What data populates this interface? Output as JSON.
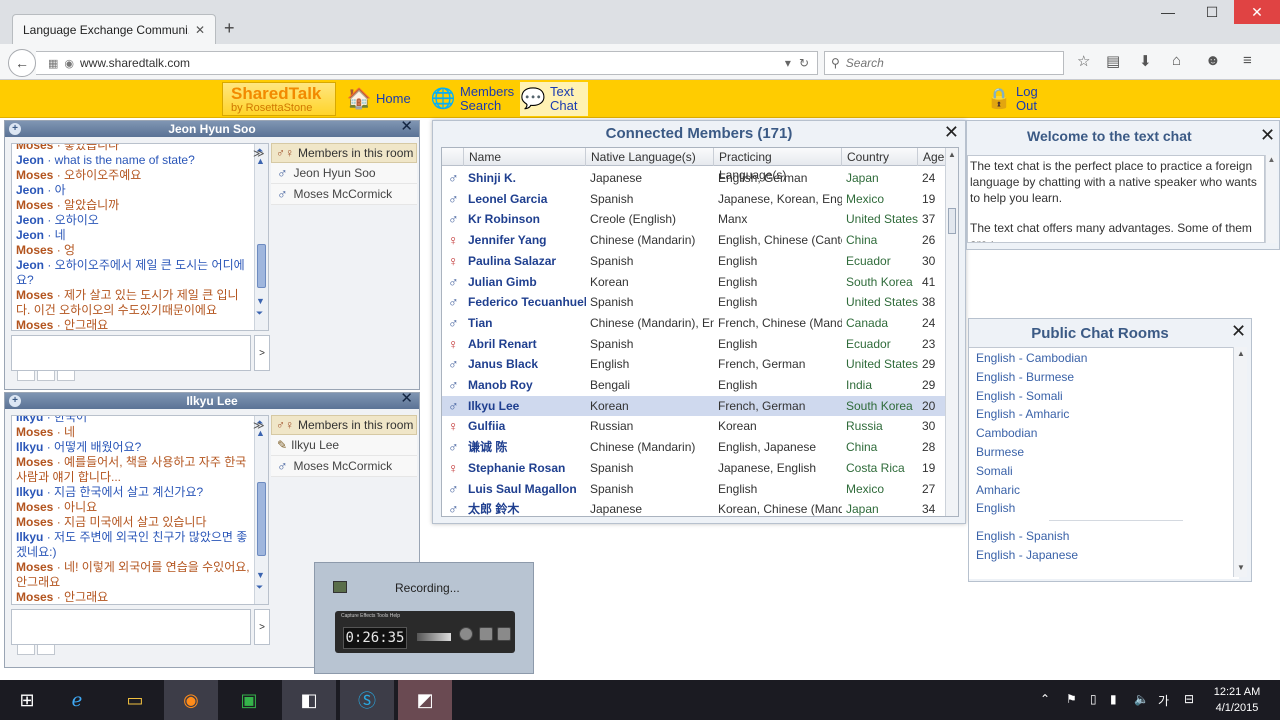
{
  "browser": {
    "tab_title": "Language Exchange Communi...",
    "url": "www.sharedtalk.com",
    "search_placeholder": "Search"
  },
  "site": {
    "logo_main": "SharedTalk",
    "logo_sub": "by RosettaStone",
    "nav": {
      "home": "Home",
      "members_search_1": "Members",
      "members_search_2": "Search",
      "text_chat_1": "Text",
      "text_chat_2": "Chat",
      "logout_1": "Log",
      "logout_2": "Out"
    }
  },
  "chat1": {
    "title": "Jeon Hyun Soo",
    "messages": [
      {
        "who": "Moses",
        "txt": " · 좋았습니다"
      },
      {
        "who": "Jeon",
        "txt": " · what is the name of state?"
      },
      {
        "who": "Moses",
        "txt": " · 오하이오주예요"
      },
      {
        "who": "Jeon",
        "txt": " · 아"
      },
      {
        "who": "Moses",
        "txt": " · 알았습니까"
      },
      {
        "who": "Jeon",
        "txt": " · 오하이오"
      },
      {
        "who": "Jeon",
        "txt": " · 네"
      },
      {
        "who": "Moses",
        "txt": " · 엉"
      },
      {
        "who": "Jeon",
        "txt": " · 오하이오주에서 제일 큰 도시는 어디에요?"
      },
      {
        "who": "Moses",
        "txt": " · 제가 살고 있는 도시가 제일 큰 입니다. 이건 오하이오의 수도있기때문이에요"
      },
      {
        "who": "Moses",
        "txt": " · 안그래요"
      }
    ],
    "members_header": "Members in this room",
    "members": [
      "Jeon Hyun Soo",
      "Moses McCormick"
    ]
  },
  "chat2": {
    "title": "Ilkyu Lee",
    "messages": [
      {
        "who": "Ilkyu",
        "txt": " · 한국어"
      },
      {
        "who": "Moses",
        "txt": " · 네"
      },
      {
        "who": "Ilkyu",
        "txt": " · 어떻게 배웠어요?"
      },
      {
        "who": "Moses",
        "txt": " · 예를들어서, 책을 사용하고 자주 한국사람과 얘기 합니다..."
      },
      {
        "who": "Ilkyu",
        "txt": " · 지금 한국에서 살고 계신가요?"
      },
      {
        "who": "Moses",
        "txt": " · 아니요"
      },
      {
        "who": "Moses",
        "txt": " · 지금 미국에서 살고 있습니다"
      },
      {
        "who": "Ilkyu",
        "txt": " · 저도 주변에 외국인 친구가 많았으면 좋겠네요:)"
      },
      {
        "who": "Moses",
        "txt": " · 네! 이렇게 외국어를 연습을 수있어요, 안그래요"
      },
      {
        "who": "Moses",
        "txt": " · 안그래요"
      }
    ],
    "members_header": "Members in this room",
    "members": [
      "Ilkyu Lee",
      "Moses McCormick"
    ]
  },
  "connected": {
    "title": "Connected Members (171)",
    "columns": [
      "Name",
      "Native Language(s)",
      "Practicing Language(s)",
      "Country",
      "Age"
    ],
    "rows": [
      {
        "g": "m",
        "name": "Shinji K.",
        "native": "Japanese",
        "prac": "English, German",
        "country": "Japan",
        "age": "24"
      },
      {
        "g": "m",
        "name": "Leonel Garcia",
        "native": "Spanish",
        "prac": "Japanese, Korean, Eng",
        "country": "Mexico",
        "age": "19"
      },
      {
        "g": "m",
        "name": "Kr Robinson",
        "native": "Creole (English)",
        "prac": "Manx",
        "country": "United States",
        "age": "37"
      },
      {
        "g": "f",
        "name": "Jennifer Yang",
        "native": "Chinese (Mandarin)",
        "prac": "English, Chinese (Canto",
        "country": "China",
        "age": "26"
      },
      {
        "g": "f",
        "name": "Paulina Salazar",
        "native": "Spanish",
        "prac": "English",
        "country": "Ecuador",
        "age": "30"
      },
      {
        "g": "m",
        "name": "Julian Gimb",
        "native": "Korean",
        "prac": "English",
        "country": "South Korea",
        "age": "41"
      },
      {
        "g": "m",
        "name": "Federico Tecuanhuehu",
        "native": "Spanish",
        "prac": "English",
        "country": "United States",
        "age": "38"
      },
      {
        "g": "m",
        "name": "Tian",
        "native": "Chinese (Mandarin), En",
        "prac": "French, Chinese (Mand",
        "country": "Canada",
        "age": "24"
      },
      {
        "g": "f",
        "name": "Abril Renart",
        "native": "Spanish",
        "prac": "English",
        "country": "Ecuador",
        "age": "23"
      },
      {
        "g": "m",
        "name": "Janus Black",
        "native": "English",
        "prac": "French, German",
        "country": "United States",
        "age": "29"
      },
      {
        "g": "m",
        "name": "Manob Roy",
        "native": "Bengali",
        "prac": "English",
        "country": "India",
        "age": "29"
      },
      {
        "g": "m",
        "name": "Ilkyu Lee",
        "native": "Korean",
        "prac": "French, German",
        "country": "South Korea",
        "age": "20",
        "sel": true
      },
      {
        "g": "f",
        "name": "Gulfiia",
        "native": "Russian",
        "prac": "Korean",
        "country": "Russia",
        "age": "30"
      },
      {
        "g": "m",
        "name": "谦诚 陈",
        "native": "Chinese (Mandarin)",
        "prac": "English, Japanese",
        "country": "China",
        "age": "28"
      },
      {
        "g": "f",
        "name": "Stephanie Rosan",
        "native": "Spanish",
        "prac": "Japanese, English",
        "country": "Costa Rica",
        "age": "19"
      },
      {
        "g": "m",
        "name": "Luis Saul Magallon",
        "native": "Spanish",
        "prac": "English",
        "country": "Mexico",
        "age": "27"
      },
      {
        "g": "m",
        "name": "太郎 鈴木",
        "native": "Japanese",
        "prac": "Korean, Chinese (Mand",
        "country": "Japan",
        "age": "34"
      }
    ]
  },
  "welcome": {
    "title": "Welcome to the text chat",
    "p1": "The text chat is the perfect place to practice a foreign language by chatting with a native speaker who wants to help you learn.",
    "p2": "The text chat offers many advantages. Some of them are :"
  },
  "rooms": {
    "title": "Public Chat Rooms",
    "items": [
      "English - Cambodian",
      "English - Burmese",
      "English - Somali",
      "English - Amharic",
      "Cambodian",
      "Burmese",
      "Somali",
      "Amharic",
      "English"
    ],
    "items2": [
      "English - Spanish",
      "English - Japanese"
    ]
  },
  "recorder": {
    "label": "Recording...",
    "time": "0:26:35",
    "menu": "Capture  Effects  Tools  Help"
  },
  "taskbar": {
    "time": "12:21 AM",
    "date": "4/1/2015",
    "ime": "가"
  }
}
